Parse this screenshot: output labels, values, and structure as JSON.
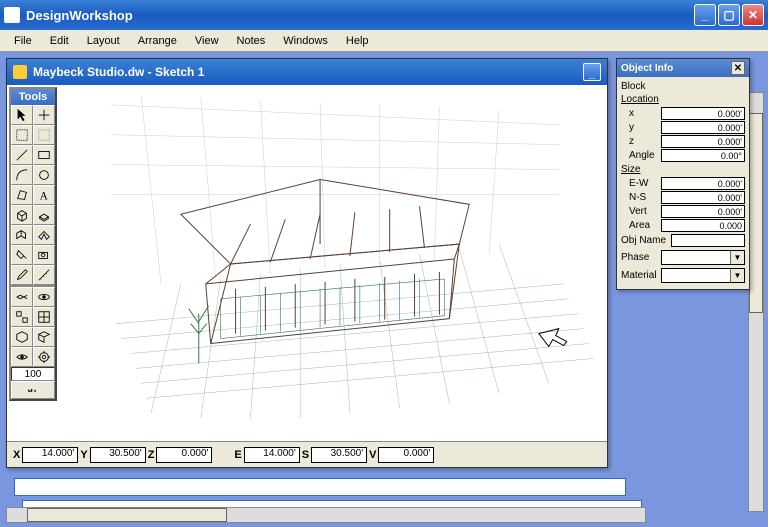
{
  "app": {
    "title": "DesignWorkshop"
  },
  "menu": {
    "items": [
      "File",
      "Edit",
      "Layout",
      "Arrange",
      "View",
      "Notes",
      "Windows",
      "Help"
    ]
  },
  "document": {
    "title": "Maybeck Studio.dw - Sketch 1"
  },
  "tools": {
    "title": "Tools",
    "zoom": "100"
  },
  "coords": {
    "x_label": "X",
    "x": "14.000'",
    "y_label": "Y",
    "y": "30.500'",
    "z_label": "Z",
    "z": "0.000'",
    "e_label": "E",
    "e": "14.000'",
    "s_label": "S",
    "s": "30.500'",
    "v_label": "V",
    "v": "0.000'"
  },
  "object_info": {
    "title": "Object Info",
    "block_label": "Block",
    "location_label": "Location",
    "x_label": "x",
    "x": "0.000'",
    "y_label": "y",
    "y": "0.000'",
    "z_label": "z",
    "z": "0.000'",
    "angle_label": "Angle",
    "angle": "0.00°",
    "size_label": "Size",
    "ew_label": "E-W",
    "ew": "0.000'",
    "ns_label": "N-S",
    "ns": "0.000'",
    "vert_label": "Vert",
    "vert": "0.000'",
    "area_label": "Area",
    "area": "0.000",
    "objname_label": "Obj Name",
    "phase_label": "Phase",
    "material_label": "Material"
  }
}
